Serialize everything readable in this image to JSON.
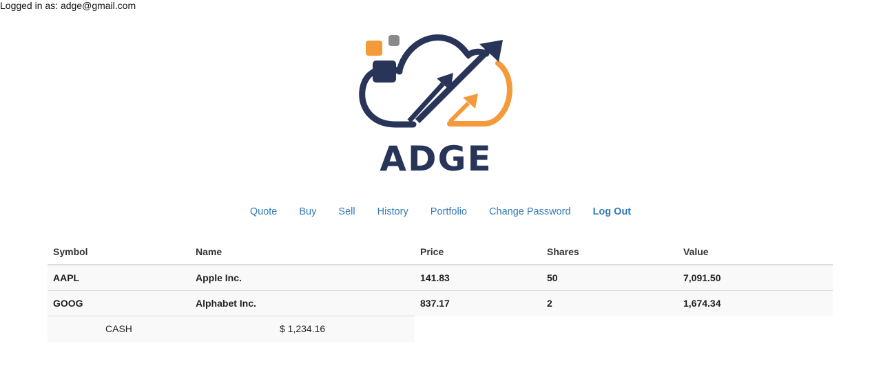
{
  "session": {
    "login_status": "Logged in as: adge@gmail.com"
  },
  "brand": {
    "name": "ADGE",
    "colors": {
      "navy": "#283559",
      "orange": "#f59a3a",
      "gray": "#8a8a8a"
    },
    "icon": "cloud-rising-arrows-logo"
  },
  "nav": {
    "quote": "Quote",
    "buy": "Buy",
    "sell": "Sell",
    "history": "History",
    "portfolio": "Portfolio",
    "change_password": "Change Password",
    "log_out": "Log Out",
    "link_color": "#337ab7"
  },
  "table": {
    "headers": {
      "symbol": "Symbol",
      "name": "Name",
      "price": "Price",
      "shares": "Shares",
      "value": "Value"
    },
    "rows": [
      {
        "symbol": "AAPL",
        "name": "Apple Inc.",
        "price": "141.83",
        "shares": "50",
        "value": "7,091.50"
      },
      {
        "symbol": "GOOG",
        "name": "Alphabet Inc.",
        "price": "837.17",
        "shares": "2",
        "value": "1,674.34"
      }
    ]
  },
  "cash": {
    "label": "CASH",
    "value": "$ 1,234.16"
  }
}
